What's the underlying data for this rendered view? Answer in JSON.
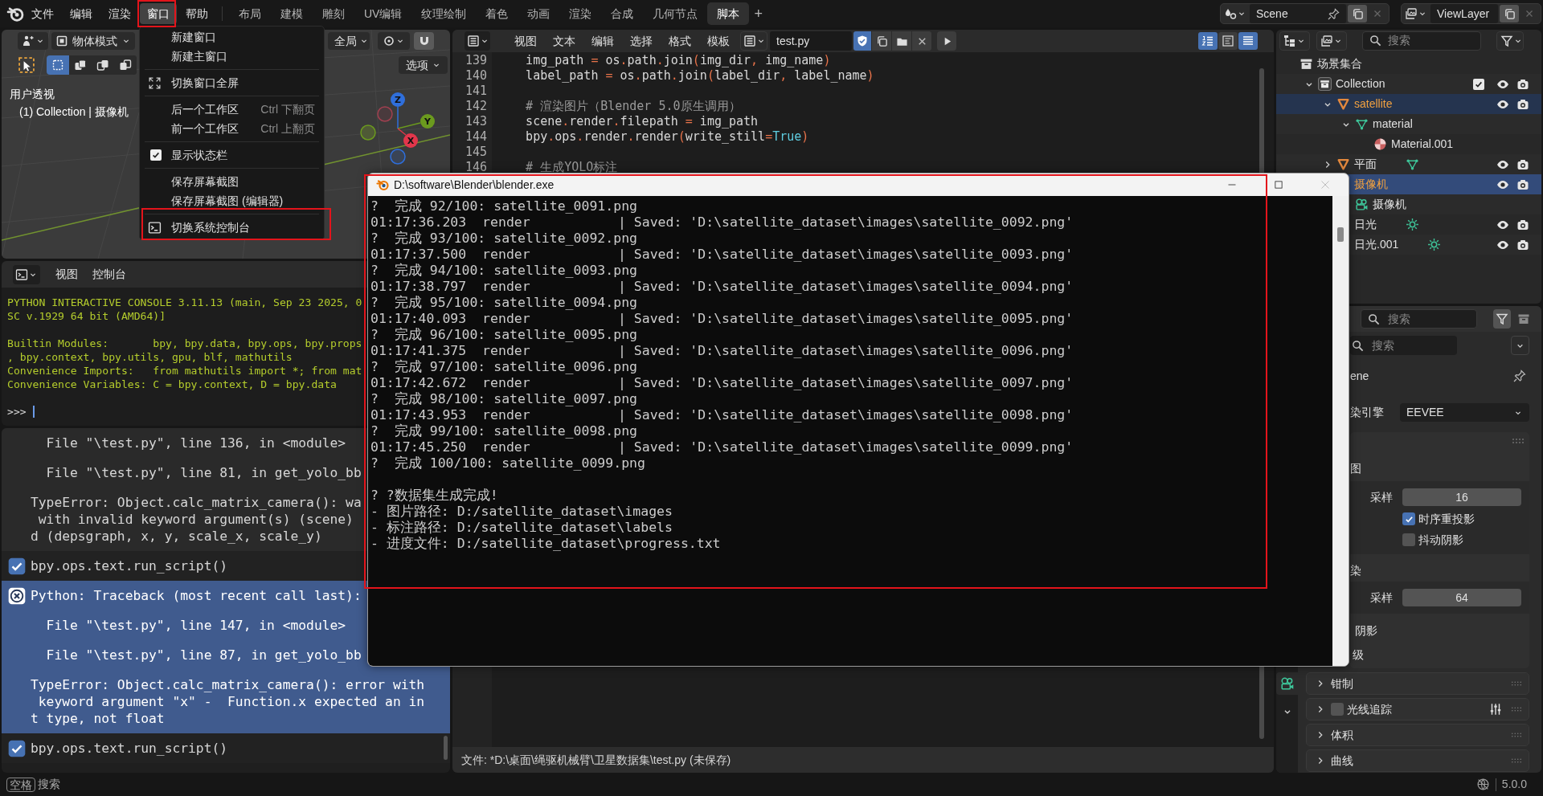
{
  "topbar": {
    "menus": [
      {
        "label": "文件",
        "selected": false
      },
      {
        "label": "编辑",
        "selected": false
      },
      {
        "label": "渲染",
        "selected": false
      },
      {
        "label": "窗口",
        "selected": true
      },
      {
        "label": "帮助",
        "selected": false
      }
    ],
    "workspaces": [
      {
        "label": "布局",
        "selected": false
      },
      {
        "label": "建模",
        "selected": false
      },
      {
        "label": "雕刻",
        "selected": false
      },
      {
        "label": "UV编辑",
        "selected": false
      },
      {
        "label": "纹理绘制",
        "selected": false
      },
      {
        "label": "着色",
        "selected": false
      },
      {
        "label": "动画",
        "selected": false
      },
      {
        "label": "渲染",
        "selected": false
      },
      {
        "label": "合成",
        "selected": false
      },
      {
        "label": "几何节点",
        "selected": false
      },
      {
        "label": "脚本",
        "selected": true
      }
    ],
    "add_workspace": "+",
    "scene": "Scene",
    "view_layer": "ViewLayer"
  },
  "window_menu": {
    "items": [
      {
        "kind": "item",
        "label": "新建窗口"
      },
      {
        "kind": "item",
        "label": "新建主窗口"
      },
      {
        "kind": "separator"
      },
      {
        "kind": "fullscreen",
        "label": "切换窗口全屏"
      },
      {
        "kind": "separator"
      },
      {
        "kind": "item",
        "label": "后一个工作区",
        "shortcut": "Ctrl 下翻页"
      },
      {
        "kind": "item",
        "label": "前一个工作区",
        "shortcut": "Ctrl 上翻页"
      },
      {
        "kind": "separator"
      },
      {
        "kind": "check",
        "label": "显示状态栏",
        "checked": true
      },
      {
        "kind": "separator"
      },
      {
        "kind": "item",
        "label": "保存屏幕截图"
      },
      {
        "kind": "item",
        "label": "保存屏幕截图 (编辑器)"
      },
      {
        "kind": "separator"
      },
      {
        "kind": "console",
        "label": "切换系统控制台"
      }
    ]
  },
  "viewport": {
    "mode": "物体模式",
    "orientation": "全局",
    "snapping": true,
    "options": "选项",
    "view_name": "用户透视",
    "collection_info": "(1) Collection | 摄像机",
    "select_modes": [
      {
        "selected": true
      },
      {
        "selected": false
      },
      {
        "selected": false
      },
      {
        "selected": false
      }
    ],
    "gizmo": [
      {
        "label": "Z",
        "color": "#2f6fdc"
      },
      {
        "label": "Y",
        "color": "#6b9a1e"
      },
      {
        "label": "X",
        "color": "#e2364b"
      }
    ]
  },
  "python_console": {
    "menus": [
      "视图",
      "控制台"
    ],
    "blocks": [
      [
        "PYTHON INTERACTIVE CONSOLE 3.11.13 (main, Sep 23 2025, 0",
        "SC v.1929 64 bit (AMD64)]"
      ],
      [
        "Builtin Modules:       bpy, bpy.data, bpy.ops, bpy.props",
        ", bpy.context, bpy.utils, gpu, blf, mathutils",
        "Convenience Imports:   from mathutils import *; from mat",
        "Convenience Variables: C = bpy.context, D = bpy.data"
      ]
    ],
    "prompt": ">>>"
  },
  "info_log": {
    "reports": [
      {
        "selected": false,
        "paragraphs": [
          [
            {
              "text": "  File \"\\test.py\", line 136, in <module>"
            }
          ],
          [
            {
              "text": "  File \"\\test.py\", line 81, in get_yolo_bb"
            }
          ],
          [
            {
              "text": "TypeError: Object.calc_matrix_camera(): wa"
            },
            {
              "text": " with invalid keyword argument(s) (scene)"
            },
            {
              "text": "d (depsgraph, x, y, scale_x, scale_y)"
            }
          ]
        ]
      },
      {
        "selected": false,
        "paragraphs": [
          [
            {
              "text": "bpy.ops.text.run_script()",
              "kind": "done"
            }
          ]
        ]
      },
      {
        "selected": true,
        "paragraphs": [
          [
            {
              "text": "Python: Traceback (most recent call last):",
              "kind": "error"
            }
          ],
          [
            {
              "text": "  File \"\\test.py\", line 147, in <module>"
            }
          ],
          [
            {
              "text": "  File \"\\test.py\", line 87, in get_yolo_bb"
            }
          ],
          [
            {
              "text": "TypeError: Object.calc_matrix_camera(): error with"
            },
            {
              "text": " keyword argument \"x\" -  Function.x expected an in"
            },
            {
              "text": "t type, not float"
            }
          ]
        ]
      },
      {
        "selected": false,
        "paragraphs": [
          [
            {
              "text": "bpy.ops.text.run_script()",
              "kind": "done"
            }
          ]
        ]
      }
    ]
  },
  "text_editor": {
    "menus": [
      "视图",
      "文本",
      "编辑",
      "选择",
      "格式",
      "模板"
    ],
    "file_name": "test.py",
    "fake_user": true,
    "toggles": [
      {
        "kind": "line_numbers",
        "on": true
      },
      {
        "kind": "word_wrap",
        "on": false
      },
      {
        "kind": "syntax",
        "on": true
      }
    ],
    "lines": [
      {
        "number": "139",
        "tokens": [
          {
            "text": "    img_path ",
            "kind": "plain"
          },
          {
            "text": "=",
            "kind": "op"
          },
          {
            "text": " os",
            "kind": "plain"
          },
          {
            "text": ".",
            "kind": "op"
          },
          {
            "text": "path",
            "kind": "plain"
          },
          {
            "text": ".",
            "kind": "op"
          },
          {
            "text": "join",
            "kind": "plain"
          },
          {
            "text": "(",
            "kind": "op"
          },
          {
            "text": "img_dir",
            "kind": "plain"
          },
          {
            "text": ",",
            "kind": "op"
          },
          {
            "text": " img_name",
            "kind": "plain"
          },
          {
            "text": ")",
            "kind": "op"
          }
        ]
      },
      {
        "number": "140",
        "tokens": [
          {
            "text": "    label_path ",
            "kind": "plain"
          },
          {
            "text": "=",
            "kind": "op"
          },
          {
            "text": " os",
            "kind": "plain"
          },
          {
            "text": ".",
            "kind": "op"
          },
          {
            "text": "path",
            "kind": "plain"
          },
          {
            "text": ".",
            "kind": "op"
          },
          {
            "text": "join",
            "kind": "plain"
          },
          {
            "text": "(",
            "kind": "op"
          },
          {
            "text": "label_dir",
            "kind": "plain"
          },
          {
            "text": ",",
            "kind": "op"
          },
          {
            "text": " label_name",
            "kind": "plain"
          },
          {
            "text": ")",
            "kind": "op"
          }
        ]
      },
      {
        "number": "141"
      },
      {
        "number": "142",
        "tokens": [
          {
            "text": "    # 渲染图片（Blender 5.0原生调用）",
            "kind": "comment"
          }
        ]
      },
      {
        "number": "143",
        "tokens": [
          {
            "text": "    scene",
            "kind": "plain"
          },
          {
            "text": ".",
            "kind": "op"
          },
          {
            "text": "render",
            "kind": "plain"
          },
          {
            "text": ".",
            "kind": "op"
          },
          {
            "text": "filepath ",
            "kind": "plain"
          },
          {
            "text": "=",
            "kind": "op"
          },
          {
            "text": " img_path",
            "kind": "plain"
          }
        ]
      },
      {
        "number": "144",
        "tokens": [
          {
            "text": "    bpy",
            "kind": "plain"
          },
          {
            "text": ".",
            "kind": "op"
          },
          {
            "text": "ops",
            "kind": "plain"
          },
          {
            "text": ".",
            "kind": "op"
          },
          {
            "text": "render",
            "kind": "plain"
          },
          {
            "text": ".",
            "kind": "op"
          },
          {
            "text": "render",
            "kind": "plain"
          },
          {
            "text": "(",
            "kind": "op"
          },
          {
            "text": "write_still",
            "kind": "plain"
          },
          {
            "text": "=",
            "kind": "op"
          },
          {
            "text": "True",
            "kind": "const"
          },
          {
            "text": ")",
            "kind": "op"
          }
        ]
      },
      {
        "number": "145"
      },
      {
        "number": "146",
        "tokens": [
          {
            "text": "    # 生成YOLO标注",
            "kind": "comment"
          }
        ]
      }
    ],
    "footer": "文件: *D:\\桌面\\绳驱机械臂\\卫星数据集\\test.py (未保存)"
  },
  "outliner": {
    "search_placeholder": "搜索",
    "tree": [
      {
        "label": "场景集合",
        "kind": "scene_collection",
        "selected": false,
        "active": false,
        "children": [
          {
            "label": "Collection",
            "kind": "collection",
            "expanded": true,
            "checked": true,
            "visible": true,
            "renderable": true,
            "selected": false,
            "active": false,
            "children": [
              {
                "label": "satellite",
                "kind": "mesh_object",
                "expanded": true,
                "visible": true,
                "renderable": true,
                "selected": true,
                "active": false,
                "children": [
                  {
                    "label": "material",
                    "kind": "mesh_data",
                    "expanded": true,
                    "selected": false,
                    "active": false,
                    "children": [
                      {
                        "label": "Material.001",
                        "kind": "material",
                        "selected": false,
                        "active": false
                      }
                    ]
                  }
                ]
              },
              {
                "label": "平面",
                "kind": "mesh_object",
                "inline": [
                  {
                    "kind": "mesh_data"
                  }
                ],
                "expanded": false,
                "visible": true,
                "renderable": true,
                "selected": false,
                "active": false
              },
              {
                "label": "摄像机",
                "visible": true,
                "renderable": true,
                "selected": true,
                "active": true,
                "children": [
                  {
                    "label": "摄像机",
                    "kind": "camera_data",
                    "selected": false,
                    "active": false
                  }
                ]
              },
              {
                "label": "日光",
                "inline": [
                  {
                    "kind": "light"
                  }
                ],
                "visible": true,
                "renderable": true,
                "selected": false,
                "active": false
              },
              {
                "label": "日光.001",
                "inline": [
                  {
                    "kind": "light"
                  }
                ],
                "visible": true,
                "renderable": true,
                "selected": false,
                "active": false
              }
            ]
          }
        ]
      }
    ]
  },
  "properties": {
    "search_placeholder": "搜索",
    "panel_search_placeholder": "搜索",
    "scene_name": "ene",
    "engine_label": "染引擎",
    "engine": "EEVEE",
    "sections": [
      {
        "title": "图",
        "samples_label": "采样",
        "samples": "16",
        "options": [
          {
            "label": "时序重投影",
            "checked": true
          },
          {
            "label": "抖动阴影",
            "checked": false
          }
        ]
      },
      {
        "title": "染",
        "samples_label": "采样",
        "samples": "64"
      }
    ],
    "extra": [
      "阴影",
      "级"
    ],
    "panels": [
      {
        "label": "钳制",
        "kind": "plain",
        "expanded": false
      },
      {
        "label": "光线追踪",
        "kind": "toggle",
        "checked": false,
        "expanded": false
      },
      {
        "label": "体积",
        "kind": "plain",
        "expanded": false
      },
      {
        "label": "曲线",
        "kind": "plain",
        "expanded": false
      }
    ]
  },
  "system_console": {
    "title": "D:\\software\\Blender\\blender.exe",
    "paragraphs": [
      [
        "?  完成 92/100: satellite_0091.png",
        "01:17:36.203  render           | Saved: 'D:\\satellite_dataset\\images\\satellite_0092.png'",
        "?  完成 93/100: satellite_0092.png",
        "01:17:37.500  render           | Saved: 'D:\\satellite_dataset\\images\\satellite_0093.png'",
        "?  完成 94/100: satellite_0093.png",
        "01:17:38.797  render           | Saved: 'D:\\satellite_dataset\\images\\satellite_0094.png'",
        "?  完成 95/100: satellite_0094.png",
        "01:17:40.093  render           | Saved: 'D:\\satellite_dataset\\images\\satellite_0095.png'",
        "?  完成 96/100: satellite_0095.png",
        "01:17:41.375  render           | Saved: 'D:\\satellite_dataset\\images\\satellite_0096.png'",
        "?  完成 97/100: satellite_0096.png",
        "01:17:42.672  render           | Saved: 'D:\\satellite_dataset\\images\\satellite_0097.png'",
        "?  完成 98/100: satellite_0097.png",
        "01:17:43.953  render           | Saved: 'D:\\satellite_dataset\\images\\satellite_0098.png'",
        "?  完成 99/100: satellite_0098.png",
        "01:17:45.250  render           | Saved: 'D:\\satellite_dataset\\images\\satellite_0099.png'",
        "?  完成 100/100: satellite_0099.png"
      ],
      [
        "? ?数据集生成完成!",
        "- 图片路径: D:/satellite_dataset\\images",
        "- 标注路径: D:/satellite_dataset\\labels",
        "- 进度文件: D:/satellite_dataset\\progress.txt"
      ]
    ]
  },
  "status_bar": {
    "key": "空格",
    "hint": "搜索",
    "version": "5.0.0"
  }
}
